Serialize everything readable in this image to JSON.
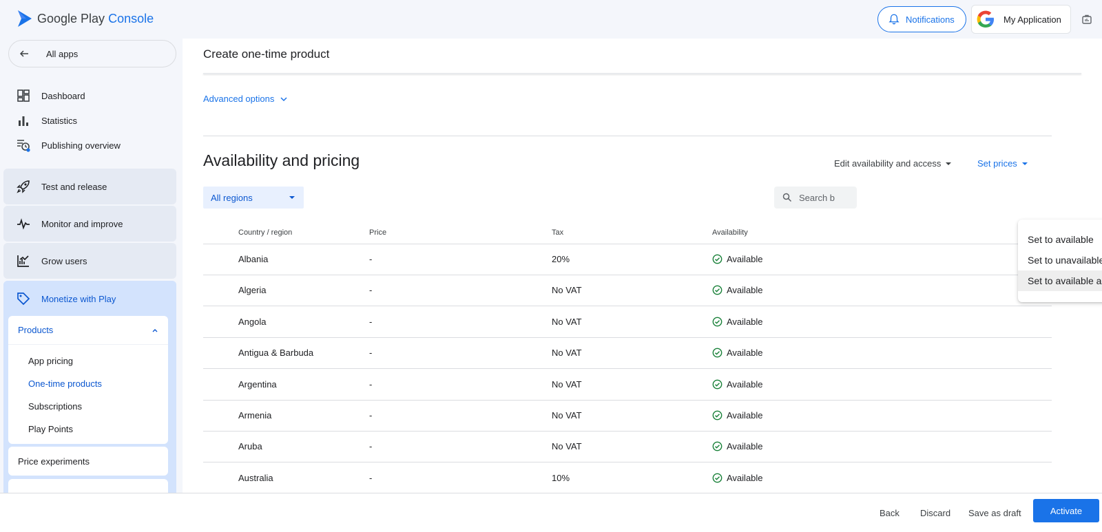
{
  "app": {
    "logo_text": "Google Play",
    "logo_accent": "Console",
    "notifications_label": "Notifications",
    "account_name": "My Application",
    "brand_color": "#1a73e8"
  },
  "sidebar": {
    "back_label": "All apps",
    "top_items": [
      {
        "label": "Dashboard",
        "icon": "dashboard-icon"
      },
      {
        "label": "Statistics",
        "icon": "bar-chart-icon"
      },
      {
        "label": "Publishing overview",
        "icon": "publishing-icon"
      }
    ],
    "groups": [
      {
        "label": "Test and release",
        "icon": "rocket-icon"
      },
      {
        "label": "Monitor and improve",
        "icon": "pulse-icon"
      },
      {
        "label": "Grow users",
        "icon": "growth-icon"
      },
      {
        "label": "Monetize with Play",
        "icon": "tag-icon"
      }
    ],
    "products": {
      "label": "Products",
      "items": [
        "App pricing",
        "One-time products",
        "Subscriptions",
        "Play Points"
      ],
      "active_item": "One-time products"
    },
    "price_experiments": "Price experiments"
  },
  "main": {
    "page_title": "Create one-time product",
    "advanced_options": "Advanced options",
    "section_title": "Availability and pricing",
    "edit_availability": "Edit availability and access",
    "set_prices": "Set prices",
    "region_selector": "All regions",
    "search_placeholder": "Search b",
    "table": {
      "headers": [
        "Country / region",
        "Price",
        "Tax",
        "Availability"
      ],
      "rows": [
        {
          "country": "Albania",
          "price": "-",
          "tax": "20%",
          "availability": "Available"
        },
        {
          "country": "Algeria",
          "price": "-",
          "tax": "No VAT",
          "availability": "Available"
        },
        {
          "country": "Angola",
          "price": "-",
          "tax": "No VAT",
          "availability": "Available"
        },
        {
          "country": "Antigua & Barbuda",
          "price": "-",
          "tax": "No VAT",
          "availability": "Available"
        },
        {
          "country": "Argentina",
          "price": "-",
          "tax": "No VAT",
          "availability": "Available"
        },
        {
          "country": "Armenia",
          "price": "-",
          "tax": "No VAT",
          "availability": "Available"
        },
        {
          "country": "Aruba",
          "price": "-",
          "tax": "No VAT",
          "availability": "Available"
        },
        {
          "country": "Australia",
          "price": "-",
          "tax": "10%",
          "availability": "Available"
        }
      ]
    }
  },
  "dropdown_menu": {
    "items": [
      "Set to available",
      "Set to unavailable",
      "Set to available and allow users to pre-order"
    ],
    "highlighted": "Set to available and allow users to pre-order"
  },
  "footer": {
    "back": "Back",
    "discard": "Discard",
    "save_draft": "Save as draft",
    "activate": "Activate"
  }
}
